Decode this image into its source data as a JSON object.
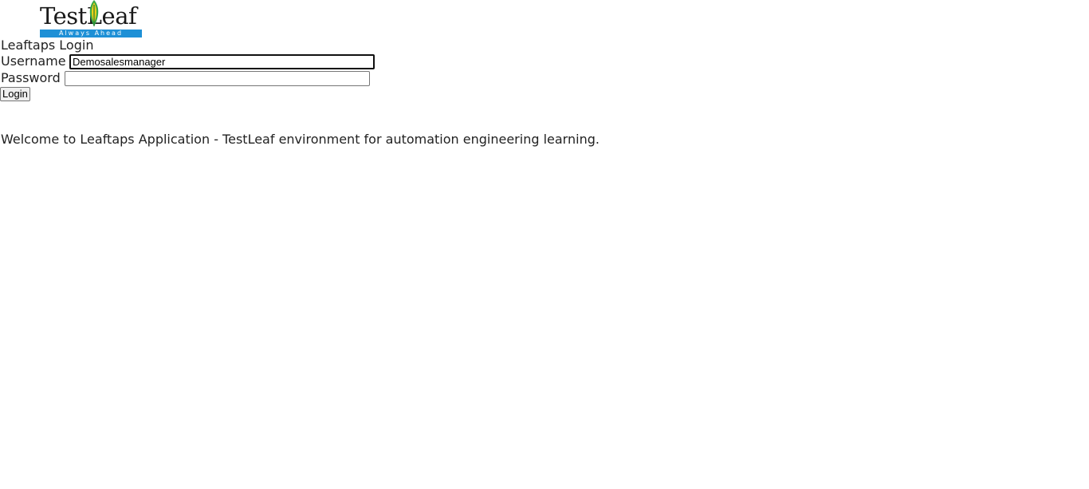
{
  "logo": {
    "wordmark": "TestLeaf",
    "tagline": "Always Ahead"
  },
  "login": {
    "title": "Leaftaps Login",
    "username_label": "Username",
    "username_value": "Demosalesmanager",
    "password_label": "Password",
    "password_value": "",
    "button_label": "Login"
  },
  "welcome_text": "Welcome to Leaftaps Application - TestLeaf environment for automation engineering learning.",
  "colors": {
    "tagline_bar": "#1e90d6",
    "leaf_green": "#3aa845",
    "leaf_yellow": "#f2d21b"
  }
}
